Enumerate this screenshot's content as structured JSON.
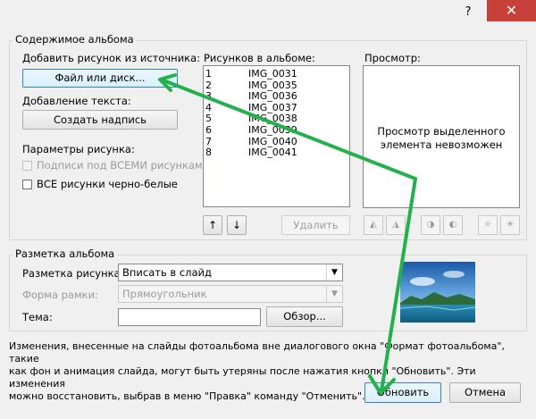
{
  "window": {
    "help_glyph": "?",
    "close_glyph": "✕"
  },
  "album_contents": {
    "group_label": "Содержимое альбома",
    "insert_from_label": "Добавить рисунок из источника:",
    "file_disk_button": "Файл или диск...",
    "add_text_label": "Добавление текста:",
    "create_caption_button": "Создать надпись",
    "picture_options_label": "Параметры рисунка:",
    "captions_below_all": "Подписи под ВСЕМИ рисунками",
    "all_black_white": "ВСЕ рисунки черно-белые"
  },
  "pictures_list": {
    "label": "Рисунков в альбоме:",
    "items": [
      {
        "num": "1",
        "name": "IMG_0031"
      },
      {
        "num": "2",
        "name": "IMG_0035"
      },
      {
        "num": "3",
        "name": "IMG_0036"
      },
      {
        "num": "4",
        "name": "IMG_0037"
      },
      {
        "num": "5",
        "name": "IMG_0038"
      },
      {
        "num": "6",
        "name": "IMG_0039"
      },
      {
        "num": "7",
        "name": "IMG_0040"
      },
      {
        "num": "8",
        "name": "IMG_0041"
      }
    ],
    "move_up_glyph": "↑",
    "move_down_glyph": "↓",
    "remove_button": "Удалить"
  },
  "preview": {
    "label": "Просмотр:",
    "message_line1": "Просмотр выделенного",
    "message_line2": "элемента невозможен"
  },
  "album_layout": {
    "group_label": "Разметка альбома",
    "picture_layout_label": "Разметка рисунка:",
    "picture_layout_value": "Вписать в слайд",
    "frame_shape_label": "Форма рамки:",
    "frame_shape_value": "Прямоугольник",
    "theme_label": "Тема:",
    "theme_value": "",
    "browse_button": "Обзор..."
  },
  "info_text": {
    "line1": "Изменения, внесенные на слайды фотоальбома вне диалогового окна \"Формат фотоальбома\", такие",
    "line2": "как фон и анимация слайда, могут быть утеряны после нажатия кнопки \"Обновить\". Эти изменения",
    "line3": "можно восстановить, выбрав в меню \"Правка\" команду \"Отменить\"."
  },
  "footer": {
    "update_button": "Обновить",
    "cancel_button": "Отмена"
  },
  "annotation": {
    "arrow_color": "#22b14c"
  }
}
